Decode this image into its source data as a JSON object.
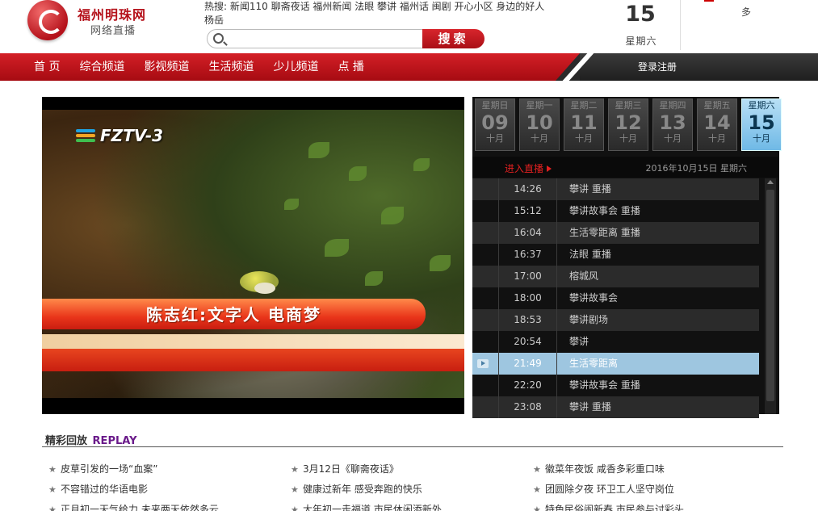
{
  "brand": {
    "name": "福州明珠网",
    "sub": "网络直播"
  },
  "hot": {
    "label": "热搜:",
    "terms": "新闻110 聊斋夜话 福州新闻 法眼 攀讲 福州话 闽剧 开心小区 身边的好人 杨岳"
  },
  "search": {
    "placeholder": "",
    "button": "搜索"
  },
  "date": {
    "day": "15",
    "weekday": "星期六"
  },
  "weather": {
    "text": "多"
  },
  "nav": {
    "items": [
      "首 页",
      "综合频道",
      "影视频道",
      "生活频道",
      "少儿频道",
      "点 播"
    ],
    "login": "登录注册"
  },
  "player": {
    "channel": "FZTV-3",
    "caption": "陈志红:文字人 电商梦"
  },
  "epg": {
    "days": [
      {
        "wk": "星期日",
        "num": "09",
        "mo": "十月"
      },
      {
        "wk": "星期一",
        "num": "10",
        "mo": "十月"
      },
      {
        "wk": "星期二",
        "num": "11",
        "mo": "十月"
      },
      {
        "wk": "星期三",
        "num": "12",
        "mo": "十月"
      },
      {
        "wk": "星期四",
        "num": "13",
        "mo": "十月"
      },
      {
        "wk": "星期五",
        "num": "14",
        "mo": "十月"
      },
      {
        "wk": "星期六",
        "num": "15",
        "mo": "十月"
      }
    ],
    "live_label": "进入直播",
    "date_label": "2016年10月15日 星期六",
    "rows": [
      {
        "time": "14:26",
        "program": "攀讲 重播"
      },
      {
        "time": "15:12",
        "program": "攀讲故事会 重播"
      },
      {
        "time": "16:04",
        "program": "生活零距离 重播"
      },
      {
        "time": "16:37",
        "program": "法眼 重播"
      },
      {
        "time": "17:00",
        "program": "榕城风"
      },
      {
        "time": "18:00",
        "program": "攀讲故事会"
      },
      {
        "time": "18:53",
        "program": "攀讲剧场"
      },
      {
        "time": "20:54",
        "program": "攀讲"
      },
      {
        "time": "21:49",
        "program": "生活零距离"
      },
      {
        "time": "22:20",
        "program": "攀讲故事会 重播"
      },
      {
        "time": "23:08",
        "program": "攀讲 重播"
      }
    ]
  },
  "replay": {
    "title": "精彩回放",
    "title_en": "REPLAY",
    "col1": [
      "皮草引发的一场“血案”",
      "不容错过的华语电影",
      "正月初一天气给力 未来两天依然多云"
    ],
    "col2": [
      "3月12日《聊斋夜话》",
      "健康过新年 感受奔跑的快乐",
      "大年初一走福道 市民休闲添新外"
    ],
    "col3": [
      "徽菜年夜饭 咸香多彩重口味",
      "团圆除夕夜 环卫工人坚守岗位",
      "特色民俗闹新春 市民参与讨彩头"
    ]
  }
}
